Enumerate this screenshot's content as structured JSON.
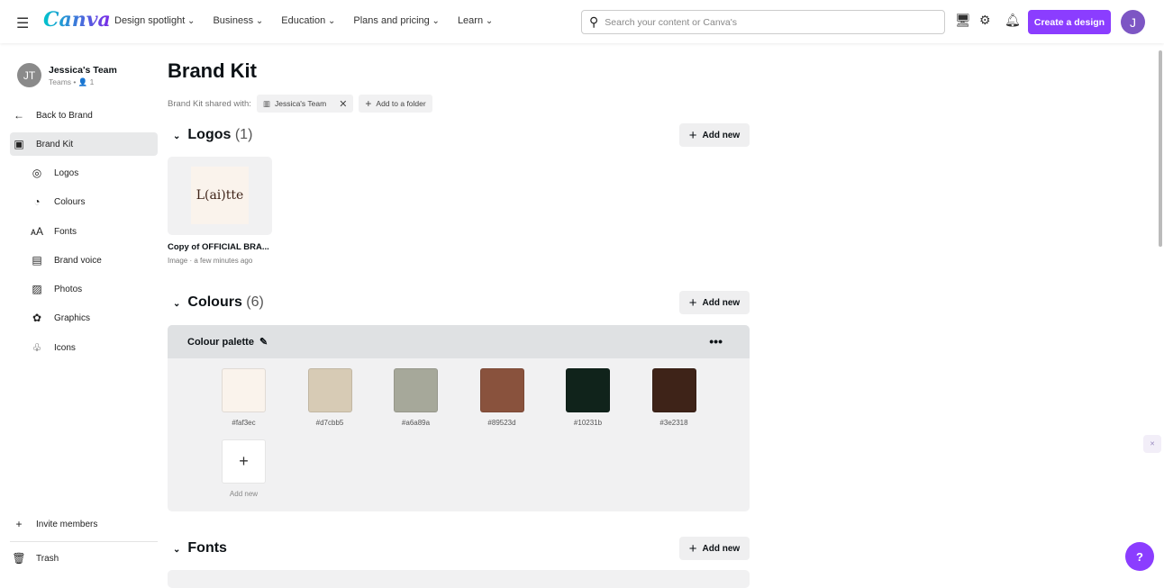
{
  "header": {
    "logo": "Canva",
    "nav": [
      "Design spotlight",
      "Business",
      "Education",
      "Plans and pricing",
      "Learn"
    ],
    "search_placeholder": "Search your content or Canva's",
    "create": "Create a design",
    "avatar": "J"
  },
  "sidebar": {
    "team_initials": "JT",
    "team_name": "Jessica's Team",
    "team_sub": "Teams • 👤 1",
    "back": "Back to Brand",
    "items": [
      {
        "label": "Brand Kit",
        "icon": "brand-kit-icon"
      },
      {
        "label": "Logos",
        "icon": "logo-icon"
      },
      {
        "label": "Colours",
        "icon": "palette-icon"
      },
      {
        "label": "Fonts",
        "icon": "font-icon"
      },
      {
        "label": "Brand voice",
        "icon": "message-icon"
      },
      {
        "label": "Photos",
        "icon": "image-icon"
      },
      {
        "label": "Graphics",
        "icon": "shapes-icon"
      },
      {
        "label": "Icons",
        "icon": "icons-icon"
      }
    ],
    "invite": "Invite members",
    "trash": "Trash"
  },
  "main": {
    "title": "Brand Kit",
    "shared_label": "Brand Kit shared with:",
    "shared_team": "Jessica's Team",
    "add_folder": "Add to a folder",
    "logos": {
      "title": "Logos",
      "count": "(1)",
      "add": "Add new",
      "item": {
        "logo_text": "L(ai)tte",
        "name": "Copy of OFFICIAL BRA...",
        "meta": "Image · a few minutes ago"
      }
    },
    "colours": {
      "title": "Colours",
      "count": "(6)",
      "add": "Add new",
      "palette": "Colour palette",
      "swatches": [
        "#faf3ec",
        "#d7cbb5",
        "#a6a89a",
        "#89523d",
        "#10231b",
        "#3e2318"
      ],
      "add_swatch": "Add new"
    },
    "fonts": {
      "title": "Fonts",
      "add": "Add new"
    }
  },
  "help": "?"
}
